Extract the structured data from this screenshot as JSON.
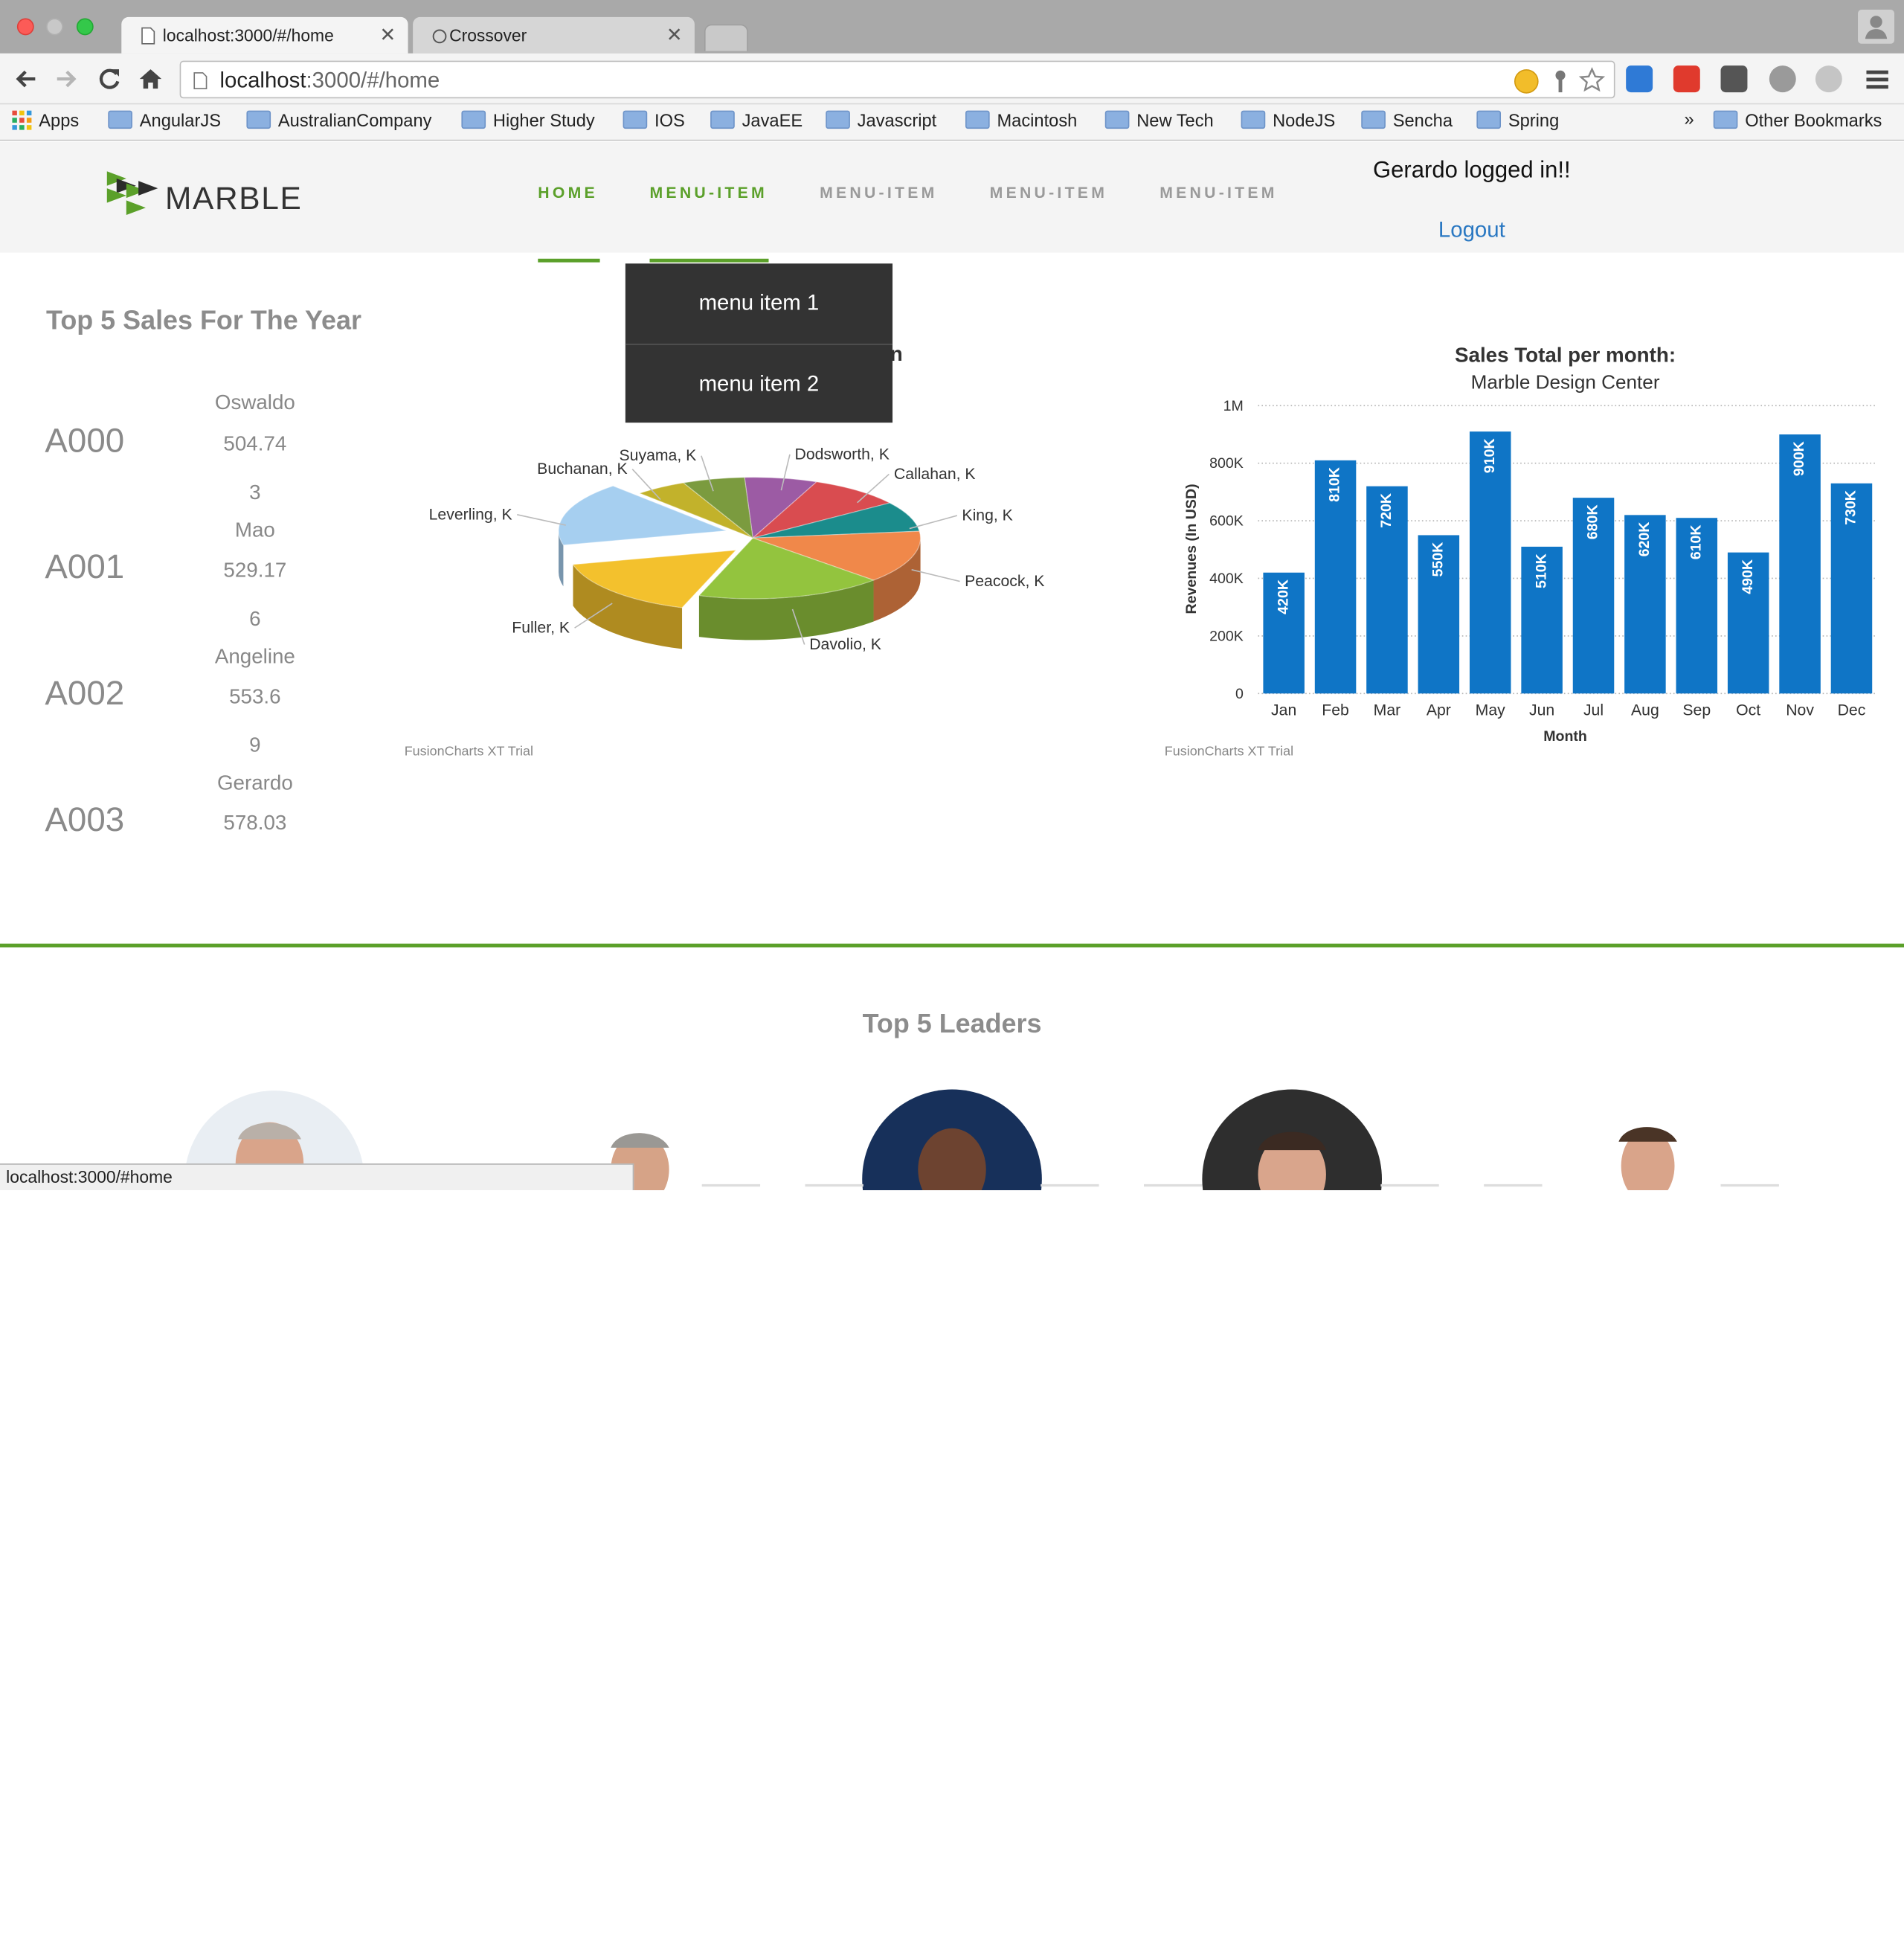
{
  "browser": {
    "tabs": [
      {
        "title": "localhost:3000/#/home",
        "active": true
      },
      {
        "title": "Crossover",
        "active": false
      }
    ],
    "address": {
      "host": "localhost",
      "path": ":3000/#/home"
    },
    "bookmarks": [
      "Apps",
      "AngularJS",
      "AustralianCompany",
      "Higher Study",
      "IOS",
      "JavaEE",
      "Javascript",
      "Macintosh",
      "New Tech",
      "NodeJS",
      "Sencha",
      "Spring"
    ],
    "overflow_glyph": "»",
    "other_bookmarks": "Other Bookmarks",
    "status_url": "localhost:3000/#home"
  },
  "header": {
    "logo_text": "MARBLE",
    "menu": [
      {
        "label": "HOME",
        "active": true
      },
      {
        "label": "MENU-ITEM",
        "active": true
      },
      {
        "label": "MENU-ITEM",
        "active": false
      },
      {
        "label": "MENU-ITEM",
        "active": false
      },
      {
        "label": "MENU-ITEM",
        "active": false
      }
    ],
    "user_status": "Gerardo logged in!!",
    "logout_label": "Logout"
  },
  "dropdown": {
    "items": [
      "menu item 1",
      "menu item 2"
    ]
  },
  "sales": {
    "title": "Top 5 Sales For The Year",
    "rows": [
      {
        "id": "A000",
        "name": "Oswaldo",
        "amount": "504.74",
        "rank": "3"
      },
      {
        "id": "A001",
        "name": "Mao",
        "amount": "529.17",
        "rank": "6"
      },
      {
        "id": "A002",
        "name": "Angeline",
        "amount": "553.6",
        "rank": "9"
      },
      {
        "id": "A003",
        "name": "Gerardo",
        "amount": "578.03",
        "rank": ""
      }
    ]
  },
  "pie_chart": {
    "title_fragment": "n",
    "watermark": "FusionCharts XT Trial"
  },
  "bar_chart": {
    "watermark": "FusionCharts XT Trial"
  },
  "chart_data": [
    {
      "type": "pie",
      "title": "",
      "slices": [
        {
          "label": "Dodsworth, K",
          "value": 7,
          "color": "#9c5ba4"
        },
        {
          "label": "Callahan, K",
          "value": 9,
          "color": "#d94c50"
        },
        {
          "label": "King, K",
          "value": 8,
          "color": "#1b8c8c"
        },
        {
          "label": "Peacock, K",
          "value": 14,
          "color": "#f0884a"
        },
        {
          "label": "Davolio, K",
          "value": 18,
          "color": "#93c43e"
        },
        {
          "label": "Fuller, K",
          "value": 16,
          "color": "#f3c12d"
        },
        {
          "label": "Leverling, K",
          "value": 17,
          "color": "#a6cff0"
        },
        {
          "label": "Buchanan, K",
          "value": 5,
          "color": "#c2b22b"
        },
        {
          "label": "Suyama, K",
          "value": 6,
          "color": "#7b9b3f"
        }
      ]
    },
    {
      "type": "bar",
      "title": "Sales Total per month:",
      "subtitle": "Marble Design Center",
      "xlabel": "Month",
      "ylabel": "Revenues (In USD)",
      "categories": [
        "Jan",
        "Feb",
        "Mar",
        "Apr",
        "May",
        "Jun",
        "Jul",
        "Aug",
        "Sep",
        "Oct",
        "Nov",
        "Dec"
      ],
      "values": [
        420000,
        810000,
        720000,
        550000,
        910000,
        510000,
        680000,
        620000,
        610000,
        490000,
        900000,
        730000
      ],
      "value_labels": [
        "420K",
        "810K",
        "720K",
        "550K",
        "910K",
        "510K",
        "680K",
        "620K",
        "610K",
        "490K",
        "900K",
        "730K"
      ],
      "ylim": [
        0,
        1000000
      ],
      "yticks": [
        0,
        200000,
        400000,
        600000,
        800000,
        1000000
      ],
      "ytick_labels": [
        "0",
        "200K",
        "400K",
        "600K",
        "800K",
        "1M"
      ],
      "grid": true,
      "color": "#0f75c6"
    }
  ],
  "leaders": {
    "title": "Top 5 Leaders"
  }
}
